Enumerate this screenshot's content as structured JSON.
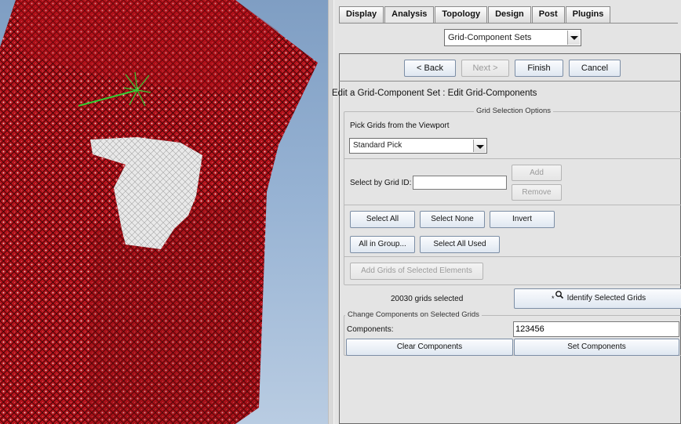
{
  "tabs": [
    {
      "label": "Display",
      "active": false
    },
    {
      "label": "Analysis",
      "active": true
    },
    {
      "label": "Topology",
      "active": false
    },
    {
      "label": "Design",
      "active": false
    },
    {
      "label": "Post",
      "active": false
    },
    {
      "label": "Plugins",
      "active": false
    }
  ],
  "mode_select": {
    "value": "Grid-Component Sets"
  },
  "wizard": {
    "back": "< Back",
    "next": "Next >",
    "finish": "Finish",
    "cancel": "Cancel"
  },
  "edit_title": "Edit a Grid-Component Set : Edit Grid-Components",
  "grid_selection": {
    "legend": "Grid Selection Options",
    "pick_label": "Pick Grids from the Viewport",
    "pick_mode": "Standard Pick",
    "select_by_id_label": "Select by Grid ID:",
    "grid_id_value": "",
    "add": "Add",
    "remove": "Remove",
    "select_all": "Select All",
    "select_none": "Select None",
    "invert": "Invert",
    "all_in_group": "All in Group...",
    "select_all_used": "Select All Used",
    "add_grids_elements": "Add Grids of Selected Elements"
  },
  "status": {
    "grids_selected": "20030 grids selected",
    "identify": "Identify Selected Grids"
  },
  "change_components": {
    "legend": "Change Components on Selected Grids",
    "components_label": "Components:",
    "components_value": "123456",
    "clear": "Clear Components",
    "set": "Set Components"
  },
  "icons": {
    "identify": "magnifier-star-icon",
    "dropdown": "chevron-down-icon",
    "triad": "axis-triad-icon"
  },
  "colors": {
    "mesh": "#b5121b",
    "selected_grids": "#e8e8e8",
    "triad": "#33cc33",
    "background_top": "#7f9ec3"
  }
}
